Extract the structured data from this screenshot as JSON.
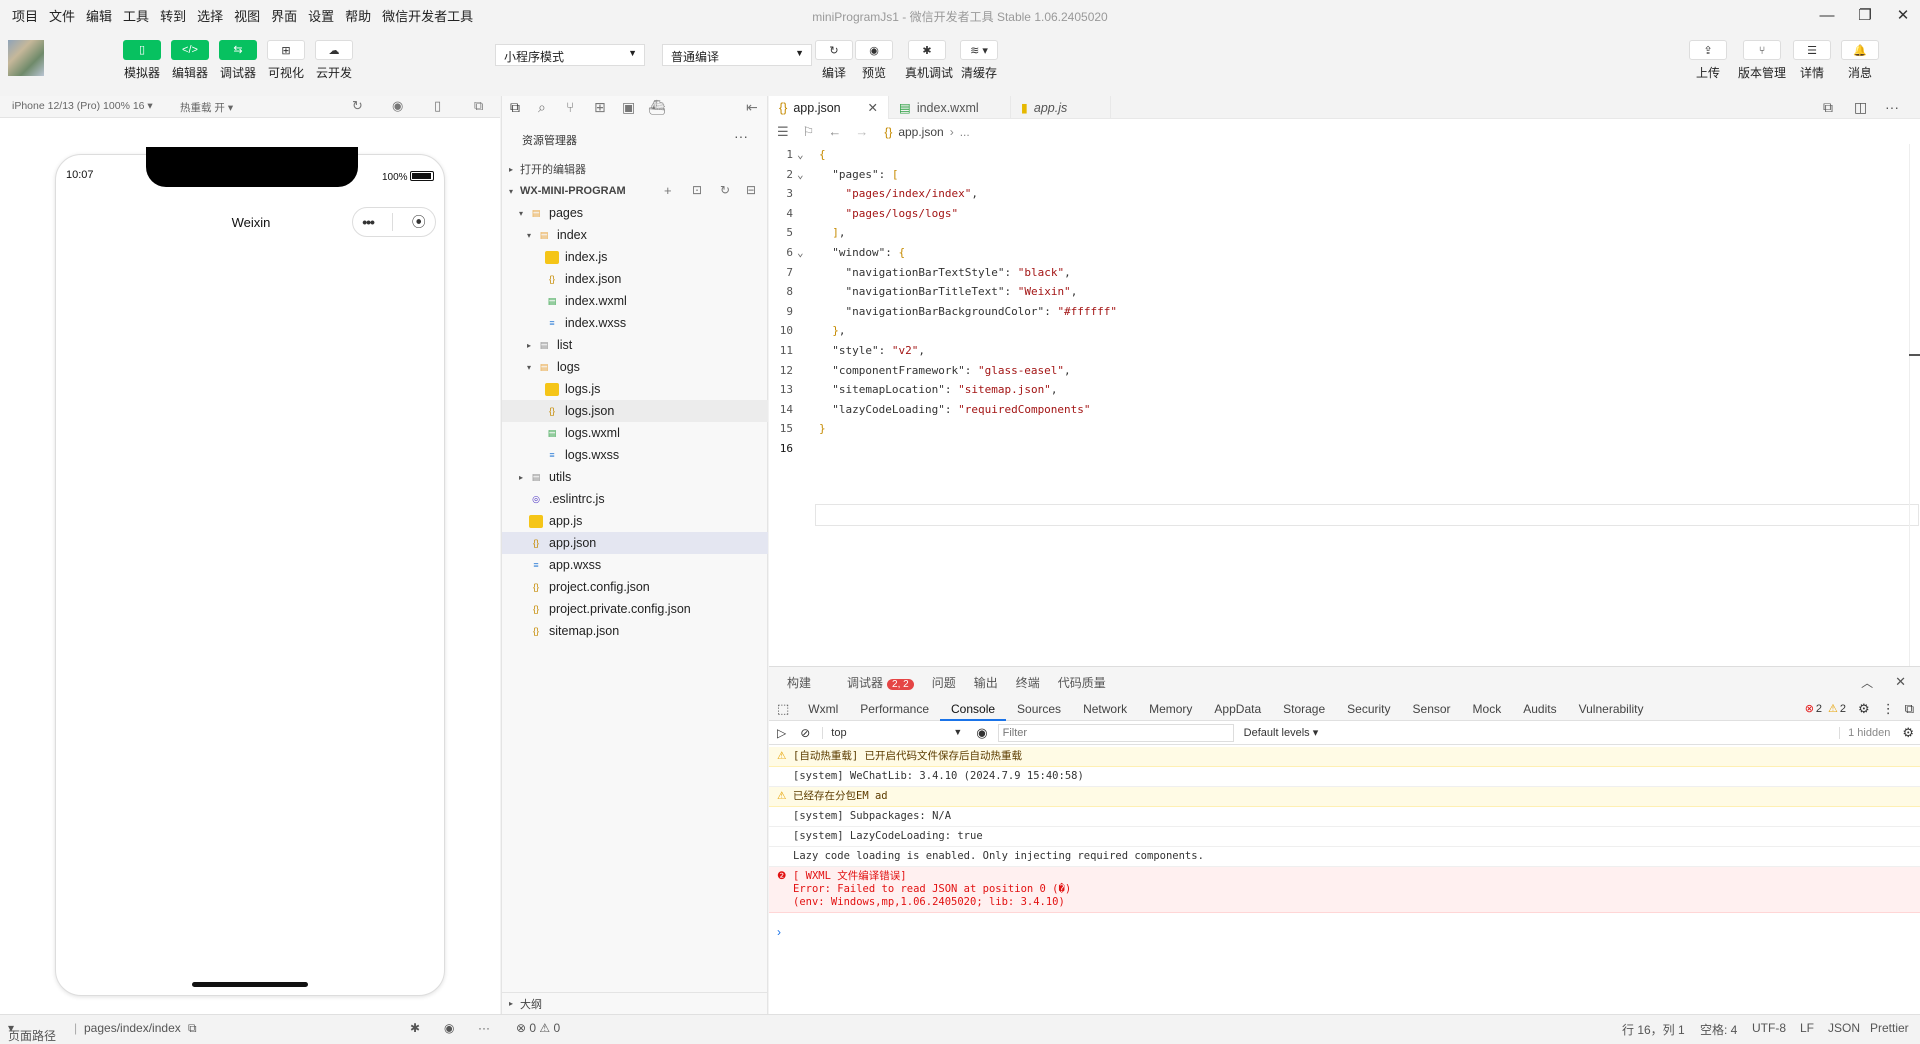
{
  "menu": [
    "项目",
    "文件",
    "编辑",
    "工具",
    "转到",
    "选择",
    "视图",
    "界面",
    "设置",
    "帮助",
    "微信开发者工具"
  ],
  "window_title": "miniProgramJs1 - 微信开发者工具 Stable 1.06.2405020",
  "toolbar": {
    "left_buttons": [
      "模拟器",
      "编辑器",
      "调试器",
      "可视化",
      "云开发"
    ],
    "mode_select": "小程序模式",
    "compile_select": "普通编译",
    "mid_buttons": [
      "编译",
      "预览",
      "真机调试",
      "清缓存"
    ],
    "right_buttons": [
      "上传",
      "版本管理",
      "详情",
      "消息"
    ]
  },
  "simulator": {
    "device": "iPhone 12/13 (Pro) 100% 16",
    "hot_reload": "热重载 开",
    "time": "10:07",
    "battery": "100%",
    "nav_title": "Weixin"
  },
  "explorer": {
    "title": "资源管理器",
    "open_editors": "打开的编辑器",
    "project": "WX-MINI-PROGRAM",
    "tree": [
      {
        "name": "pages",
        "depth": 0,
        "type": "folder-open"
      },
      {
        "name": "index",
        "depth": 1,
        "type": "folder-open"
      },
      {
        "name": "index.js",
        "depth": 2,
        "type": "js"
      },
      {
        "name": "index.json",
        "depth": 2,
        "type": "json"
      },
      {
        "name": "index.wxml",
        "depth": 2,
        "type": "wxml"
      },
      {
        "name": "index.wxss",
        "depth": 2,
        "type": "wxss"
      },
      {
        "name": "list",
        "depth": 1,
        "type": "folder"
      },
      {
        "name": "logs",
        "depth": 1,
        "type": "folder-open"
      },
      {
        "name": "logs.js",
        "depth": 2,
        "type": "js"
      },
      {
        "name": "logs.json",
        "depth": 2,
        "type": "json"
      },
      {
        "name": "logs.wxml",
        "depth": 2,
        "type": "wxml"
      },
      {
        "name": "logs.wxss",
        "depth": 2,
        "type": "wxss"
      },
      {
        "name": "utils",
        "depth": 0,
        "type": "folder"
      },
      {
        "name": ".eslintrc.js",
        "depth": 0,
        "type": "eslint"
      },
      {
        "name": "app.js",
        "depth": 0,
        "type": "js"
      },
      {
        "name": "app.json",
        "depth": 0,
        "type": "json"
      },
      {
        "name": "app.wxss",
        "depth": 0,
        "type": "wxss"
      },
      {
        "name": "project.config.json",
        "depth": 0,
        "type": "json"
      },
      {
        "name": "project.private.config.json",
        "depth": 0,
        "type": "json"
      },
      {
        "name": "sitemap.json",
        "depth": 0,
        "type": "json"
      }
    ],
    "outline": "大纲",
    "problems": "⊗ 0 ⚠ 0"
  },
  "editor": {
    "tabs": [
      "app.json",
      "index.wxml",
      "app.js"
    ],
    "breadcrumb_file": "app.json",
    "breadcrumb_more": "...",
    "lines": [
      "{",
      "  \"pages\": [",
      "    \"pages/index/index\",",
      "    \"pages/logs/logs\"",
      "  ],",
      "  \"window\": {",
      "    \"navigationBarTextStyle\": \"black\",",
      "    \"navigationBarTitleText\": \"Weixin\",",
      "    \"navigationBarBackgroundColor\": \"#ffffff\"",
      "  },",
      "  \"style\": \"v2\",",
      "  \"componentFramework\": \"glass-easel\",",
      "  \"sitemapLocation\": \"sitemap.json\",",
      "  \"lazyCodeLoading\": \"requiredComponents\"",
      "}",
      ""
    ]
  },
  "panel": {
    "tabs": [
      "构建",
      "调试器",
      "问题",
      "输出",
      "终端",
      "代码质量"
    ],
    "debugger_badge": "2, 2",
    "devtools_tabs": [
      "Wxml",
      "Performance",
      "Console",
      "Sources",
      "Network",
      "Memory",
      "AppData",
      "Storage",
      "Security",
      "Sensor",
      "Mock",
      "Audits",
      "Vulnerability"
    ],
    "error_count": "2",
    "warn_count": "2",
    "context": "top",
    "filter_placeholder": "Filter",
    "levels": "Default levels",
    "hidden": "1 hidden",
    "console": [
      {
        "level": "warn",
        "text": "[自动热重载] 已开启代码文件保存后自动热重载"
      },
      {
        "level": "info",
        "text": "[system] WeChatLib: 3.4.10 (2024.7.9 15:40:58)"
      },
      {
        "level": "warn",
        "text": "已经存在分包EM ad"
      },
      {
        "level": "info",
        "text": "[system] Subpackages: N/A"
      },
      {
        "level": "info",
        "text": "[system] LazyCodeLoading: true"
      },
      {
        "level": "info",
        "text": "Lazy code loading is enabled. Only injecting required components."
      },
      {
        "level": "error",
        "text": "[ WXML 文件编译错误]\nError: Failed to read JSON at position 0 (�)\n(env: Windows,mp,1.06.2405020; lib: 3.4.10)"
      }
    ]
  },
  "statusbar": {
    "page_path_label": "页面路径",
    "page_path": "pages/index/index",
    "position": "行 16，列 1",
    "spaces": "空格: 4",
    "encoding": "UTF-8",
    "eol": "LF",
    "language": "JSON",
    "formatter": "Prettier"
  }
}
